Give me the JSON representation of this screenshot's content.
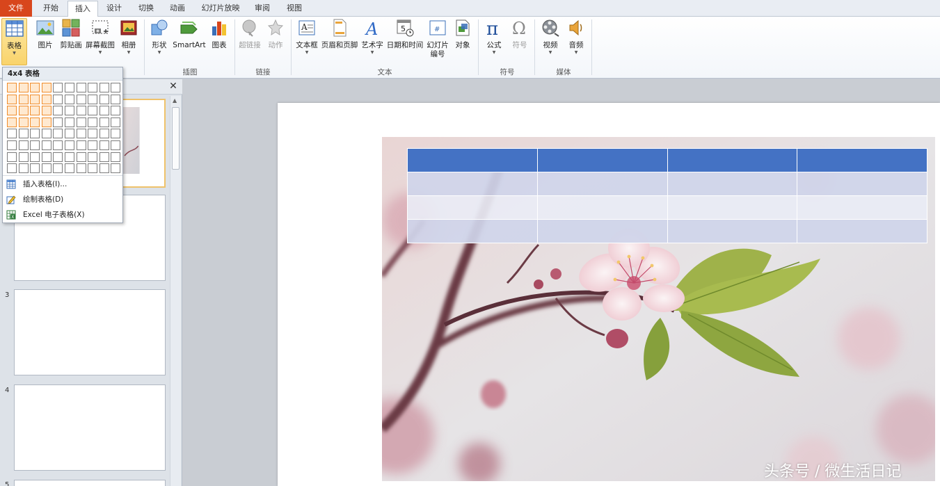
{
  "tabs": [
    {
      "label": "文件",
      "name": "tab-file"
    },
    {
      "label": "开始",
      "name": "tab-home"
    },
    {
      "label": "插入",
      "name": "tab-insert"
    },
    {
      "label": "设计",
      "name": "tab-design"
    },
    {
      "label": "切换",
      "name": "tab-transitions"
    },
    {
      "label": "动画",
      "name": "tab-animations"
    },
    {
      "label": "幻灯片放映",
      "name": "tab-slideshow"
    },
    {
      "label": "审阅",
      "name": "tab-review"
    },
    {
      "label": "视图",
      "name": "tab-view"
    }
  ],
  "ribbon": {
    "buttons": {
      "table": "表格",
      "picture": "图片",
      "clipart": "剪贴画",
      "screenshot": "屏幕截图",
      "album": "相册",
      "shapes": "形状",
      "smartart": "SmartArt",
      "chart": "图表",
      "hyperlink": "超链接",
      "action": "动作",
      "textbox": "文本框",
      "header_footer": "页眉和页脚",
      "wordart": "艺术字",
      "datetime": "日期和时间",
      "slide_number_line1": "幻灯片",
      "slide_number_line2": "编号",
      "object": "对象",
      "equation": "公式",
      "symbol": "符号",
      "video": "视频",
      "audio": "音频"
    },
    "groups": {
      "illustrations": "插图",
      "links": "链接",
      "text": "文本",
      "symbols": "符号",
      "media": "媒体"
    }
  },
  "table_menu": {
    "title": "4x4 表格",
    "grid_cols": 10,
    "grid_rows": 8,
    "selected_cols": 4,
    "selected_rows": 4,
    "items": [
      "插入表格(I)...",
      "绘制表格(D)",
      "Excel 电子表格(X)"
    ]
  },
  "slide_numbers": [
    "3",
    "4",
    "5"
  ],
  "slide_table": {
    "rows": 4,
    "cols": 4
  },
  "watermark": "头条号 / 微生活日记",
  "colors": {
    "file_tab": "#d8461c",
    "table_header": "#4472c4",
    "table_band": "#cfd5ea",
    "grid_highlight": "#f08c2b"
  }
}
